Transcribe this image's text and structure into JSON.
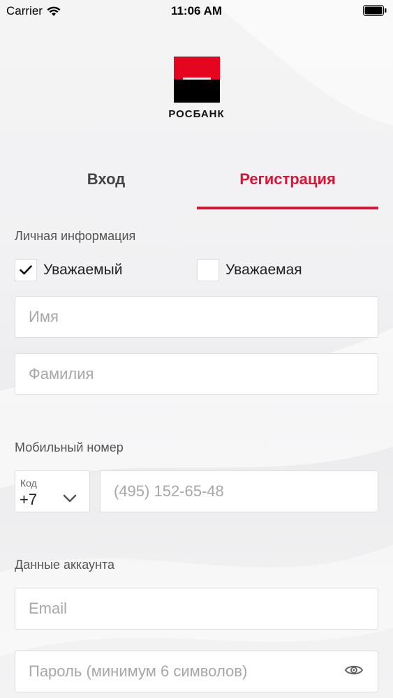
{
  "status_bar": {
    "carrier": "Carrier",
    "time": "11:06 AM"
  },
  "logo": {
    "brand": "РОСБАНК",
    "colors": {
      "red": "#e5051e",
      "black": "#000000"
    }
  },
  "tabs": {
    "login": "Вход",
    "register": "Регистрация",
    "active": "register",
    "accent_color": "#d6173a"
  },
  "personal": {
    "section_title": "Личная информация",
    "salutation_male": {
      "label": "Уважаемый",
      "checked": true
    },
    "salutation_female": {
      "label": "Уважаемая",
      "checked": false
    },
    "first_name_placeholder": "Имя",
    "last_name_placeholder": "Фамилия"
  },
  "mobile": {
    "section_title": "Мобильный номер",
    "code_label": "Код",
    "code_value": "+7",
    "phone_placeholder": "(495) 152-65-48"
  },
  "account": {
    "section_title": "Данные аккаунта",
    "email_placeholder": "Email",
    "password_placeholder": "Пароль (минимум 6 символов)"
  }
}
